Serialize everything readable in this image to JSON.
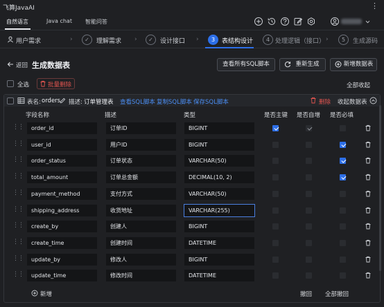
{
  "app": {
    "title": "飞算JavaAI",
    "more_label": "⋮"
  },
  "tabs": [
    {
      "label": "自然语言",
      "active": true
    },
    {
      "label": "Java chat",
      "active": false
    },
    {
      "label": "智能问答",
      "active": false
    }
  ],
  "toolbar_icons": [
    "plus-icon",
    "history-icon",
    "help-icon",
    "edit-icon",
    "settings-icon",
    "user-icon"
  ],
  "steps": [
    {
      "label": "用户需求",
      "state": "done"
    },
    {
      "label": "理解需求",
      "state": "done"
    },
    {
      "label": "设计接口",
      "state": "done"
    },
    {
      "num": "3",
      "label": "表结构设计",
      "state": "active"
    },
    {
      "num": "4",
      "label": "处理逻辑（接口）",
      "state": "pending"
    },
    {
      "num": "5",
      "label": "生成源码",
      "state": "pending"
    }
  ],
  "page": {
    "back_label": "返回",
    "title": "生成数据表",
    "view_sql_button": "查看所有SQL脚本",
    "regenerate_button": "重新生成",
    "add_table_button": "新增数据表",
    "select_all_label": "全选",
    "batch_delete_label": "批量删除",
    "collapse_all_label": "全部收起"
  },
  "table_card": {
    "name_label": "表名:",
    "name_value": "orders",
    "desc_label": "描述:",
    "desc_value": "订单管理表",
    "view_sql": "查看SQL脚本",
    "copy_sql": "复制SQL脚本",
    "save_sql": "保存SQL脚本",
    "delete_label": "删除",
    "collapse_label": "收起数据表",
    "columns": [
      "字段名称",
      "描述",
      "类型",
      "是否主键",
      "是否自增",
      "是否必填"
    ],
    "rows": [
      {
        "name": "order_id",
        "desc": "订单ID",
        "type": "BIGINT",
        "pk": "checked",
        "ai": "grey",
        "req": "none"
      },
      {
        "name": "user_id",
        "desc": "用户ID",
        "type": "BIGINT",
        "pk": "none",
        "ai": "none",
        "req": "checked"
      },
      {
        "name": "order_status",
        "desc": "订单状态",
        "type": "VARCHAR(50)",
        "pk": "none",
        "ai": "none",
        "req": "checked"
      },
      {
        "name": "total_amount",
        "desc": "订单总金额",
        "type": "DECIMAL(10, 2)",
        "pk": "none",
        "ai": "none",
        "req": "checked"
      },
      {
        "name": "payment_method",
        "desc": "支付方式",
        "type": "VARCHAR(50)",
        "pk": "none",
        "ai": "none",
        "req": "none"
      },
      {
        "name": "shipping_address",
        "desc": "收货地址",
        "type": "VARCHAR(255)",
        "pk": "none",
        "ai": "none",
        "req": "none",
        "focused": true
      },
      {
        "name": "create_by",
        "desc": "创建人",
        "type": "BIGINT",
        "pk": "none",
        "ai": "none",
        "req": "none"
      },
      {
        "name": "create_time",
        "desc": "创建时间",
        "type": "DATETIME",
        "pk": "none",
        "ai": "none",
        "req": "none"
      },
      {
        "name": "update_by",
        "desc": "修改人",
        "type": "BIGINT",
        "pk": "none",
        "ai": "none",
        "req": "none"
      },
      {
        "name": "update_time",
        "desc": "修改时间",
        "type": "DATETIME",
        "pk": "none",
        "ai": "none",
        "req": "none"
      }
    ],
    "add_label": "新增",
    "undo_label": "撤回",
    "undo_all_label": "全部撤回"
  }
}
